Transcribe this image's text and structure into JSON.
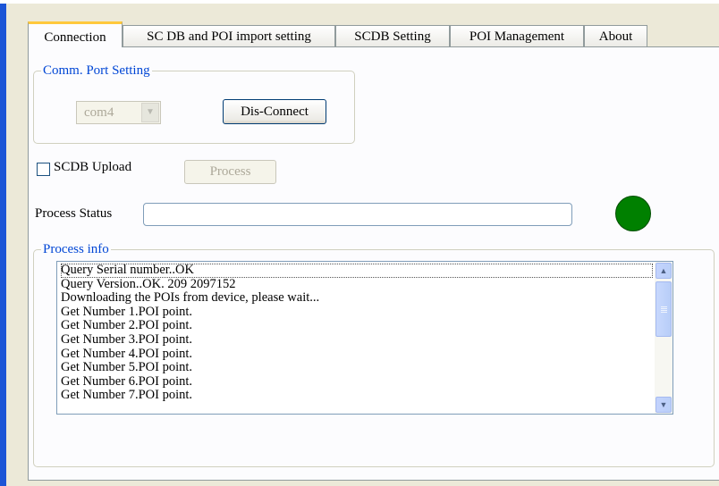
{
  "tabs": [
    {
      "label": "Connection",
      "active": true
    },
    {
      "label": "SC DB and POI import setting",
      "active": false
    },
    {
      "label": "SCDB  Setting",
      "active": false
    },
    {
      "label": "POI Management",
      "active": false
    },
    {
      "label": "About",
      "active": false
    }
  ],
  "comm_port": {
    "title": "Comm. Port Setting",
    "port_value": "com4",
    "disconnect_label": "Dis-Connect"
  },
  "scdb_upload": {
    "label": "SCDB Upload",
    "checked": false,
    "process_label": "Process"
  },
  "process_status": {
    "label": "Process Status",
    "value": "",
    "indicator_color": "#008000"
  },
  "process_info": {
    "title": "Process info",
    "lines": [
      "Query Serial number..OK",
      "Query Version..OK.  209      2097152",
      "Downloading the POIs from device, please wait...",
      "Get Number 1.POI point.",
      "Get Number 2.POI point.",
      "Get Number 3.POI point.",
      "Get Number 4.POI point.",
      "Get Number 5.POI point.",
      "Get Number 6.POI point.",
      "Get Number 7.POI point."
    ]
  }
}
